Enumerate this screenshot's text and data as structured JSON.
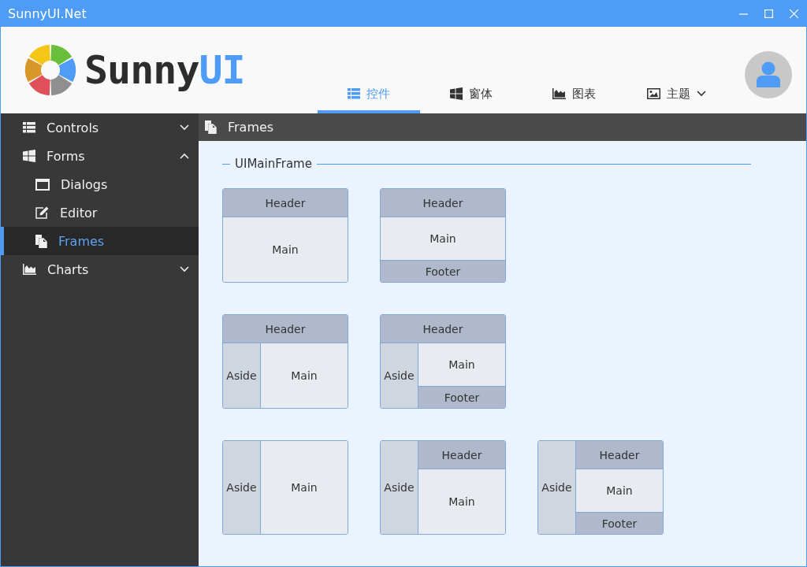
{
  "window": {
    "title": "SunnyUI.Net"
  },
  "logo": {
    "text": "Sunny",
    "accent": "UI"
  },
  "tabs": [
    {
      "label": "控件",
      "selected": true,
      "has_menu": false
    },
    {
      "label": "窗体",
      "selected": false,
      "has_menu": false
    },
    {
      "label": "图表",
      "selected": false,
      "has_menu": false
    },
    {
      "label": "主题",
      "selected": false,
      "has_menu": true
    }
  ],
  "sidebar": {
    "items": [
      {
        "label": "Controls",
        "expanded": false,
        "selected": false
      },
      {
        "label": "Forms",
        "expanded": true,
        "selected": false,
        "children": [
          {
            "label": "Dialogs",
            "selected": false
          },
          {
            "label": "Editor",
            "selected": false
          },
          {
            "label": "Frames",
            "selected": true
          }
        ]
      },
      {
        "label": "Charts",
        "expanded": false,
        "selected": false
      }
    ]
  },
  "breadcrumb": {
    "label": "Frames"
  },
  "group": {
    "title": "UIMainFrame"
  },
  "frames": [
    {
      "kind": "header-first",
      "header": "Header",
      "main": "Main"
    },
    {
      "kind": "header-first",
      "header": "Header",
      "main": "Main",
      "footer": "Footer"
    },
    {
      "kind": "header-first",
      "header": "Header",
      "aside": "Aside",
      "main": "Main"
    },
    {
      "kind": "header-first",
      "header": "Header",
      "aside": "Aside",
      "main": "Main",
      "footer": "Footer"
    },
    {
      "kind": "aside-first",
      "aside": "Aside",
      "main": "Main"
    },
    {
      "kind": "aside-first",
      "aside": "Aside",
      "header": "Header",
      "main": "Main"
    },
    {
      "kind": "aside-first",
      "aside": "Aside",
      "header": "Header",
      "main": "Main",
      "footer": "Footer"
    }
  ]
}
